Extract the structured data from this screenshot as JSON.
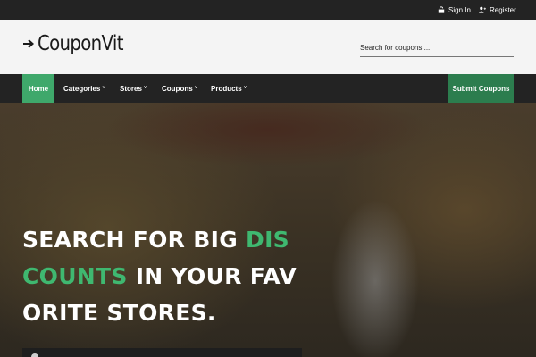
{
  "topbar": {
    "signin_label": "Sign In",
    "register_label": "Register"
  },
  "header": {
    "logo_text": "CouponVit",
    "search_placeholder": "Search for coupons ..."
  },
  "nav": {
    "home": "Home",
    "categories": "Categories",
    "stores": "Stores",
    "coupons": "Coupons",
    "products": "Products",
    "submit": "Submit Coupons",
    "caret": "˅"
  },
  "hero": {
    "title_part1": "SEARCH FOR BIG ",
    "title_accent": "DISCOUNTS",
    "title_part2": " IN YOUR FAVORITE STORES."
  },
  "colors": {
    "accent_green": "#3fa86b",
    "submit_green": "#2c7d4e",
    "dark_bar": "#232323"
  },
  "icons": [
    "lock-icon",
    "user-plus-icon",
    "arrow-right-icon",
    "chevron-down-icon",
    "search-icon"
  ]
}
